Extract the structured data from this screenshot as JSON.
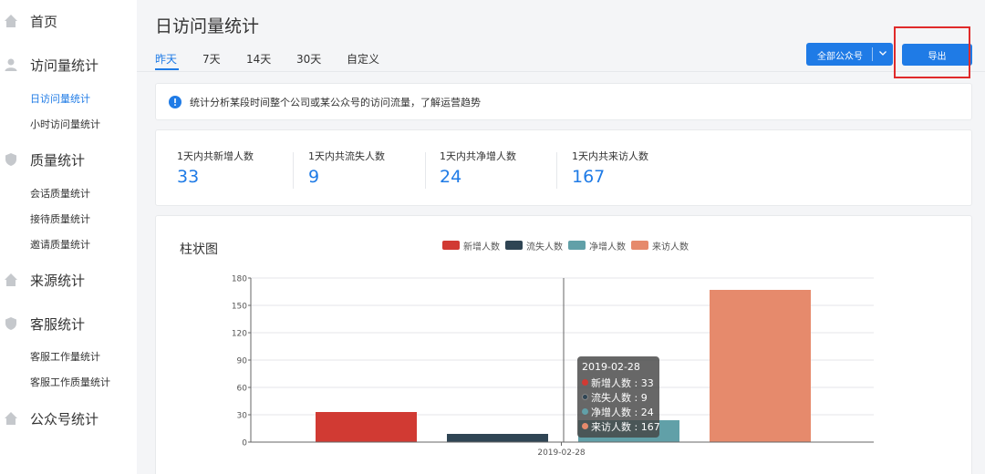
{
  "sidebar": {
    "items": [
      {
        "label": "首页",
        "icon": "home-icon"
      },
      {
        "label": "访问量统计",
        "icon": "user-icon",
        "children": [
          {
            "label": "日访问量统计",
            "active": true
          },
          {
            "label": "小时访问量统计"
          }
        ]
      },
      {
        "label": "质量统计",
        "icon": "shield-icon",
        "children": [
          {
            "label": "会话质量统计"
          },
          {
            "label": "接待质量统计"
          },
          {
            "label": "邀请质量统计"
          }
        ]
      },
      {
        "label": "来源统计",
        "icon": "home-icon"
      },
      {
        "label": "客服统计",
        "icon": "shield-icon",
        "children": [
          {
            "label": "客服工作量统计"
          },
          {
            "label": "客服工作质量统计"
          }
        ]
      },
      {
        "label": "公众号统计",
        "icon": "home-icon"
      }
    ]
  },
  "main": {
    "title": "日访问量统计",
    "tabs": [
      {
        "label": "昨天",
        "active": true
      },
      {
        "label": "7天"
      },
      {
        "label": "14天"
      },
      {
        "label": "30天"
      },
      {
        "label": "自定义"
      }
    ],
    "dropdown": {
      "selected": "全部公众号",
      "icon": "chevron-down-icon"
    },
    "export_label": "导出",
    "info": {
      "icon": "info-icon",
      "text": "统计分析某段时间整个公司或某公众号的访问流量，了解运营趋势"
    },
    "stats": [
      {
        "label": "1天内共新增人数",
        "value": "33"
      },
      {
        "label": "1天内共流失人数",
        "value": "9"
      },
      {
        "label": "1天内共净增人数",
        "value": "24"
      },
      {
        "label": "1天内共来访人数",
        "value": "167"
      }
    ]
  },
  "colors": {
    "accent": "#1f7be6",
    "highlight": "#e02a2a",
    "series": [
      "#d13a33",
      "#2f4554",
      "#61a0a8",
      "#e68a6c"
    ]
  },
  "chart_data": {
    "type": "bar",
    "title": "柱状图",
    "categories": [
      "2019-02-28"
    ],
    "series": [
      {
        "name": "新增人数",
        "values": [
          33
        ]
      },
      {
        "name": "流失人数",
        "values": [
          9
        ]
      },
      {
        "name": "净增人数",
        "values": [
          24
        ]
      },
      {
        "name": "来访人数",
        "values": [
          167
        ]
      }
    ],
    "ylim": [
      0,
      180
    ],
    "yticks": [
      "0",
      "30",
      "60",
      "90",
      "120",
      "150",
      "180"
    ],
    "grid": true,
    "legend": "top",
    "tooltip": {
      "title": "2019-02-28",
      "rows": [
        "新增人数 : 33",
        "流失人数 : 9",
        "净增人数 : 24",
        "来访人数 : 167"
      ]
    }
  }
}
